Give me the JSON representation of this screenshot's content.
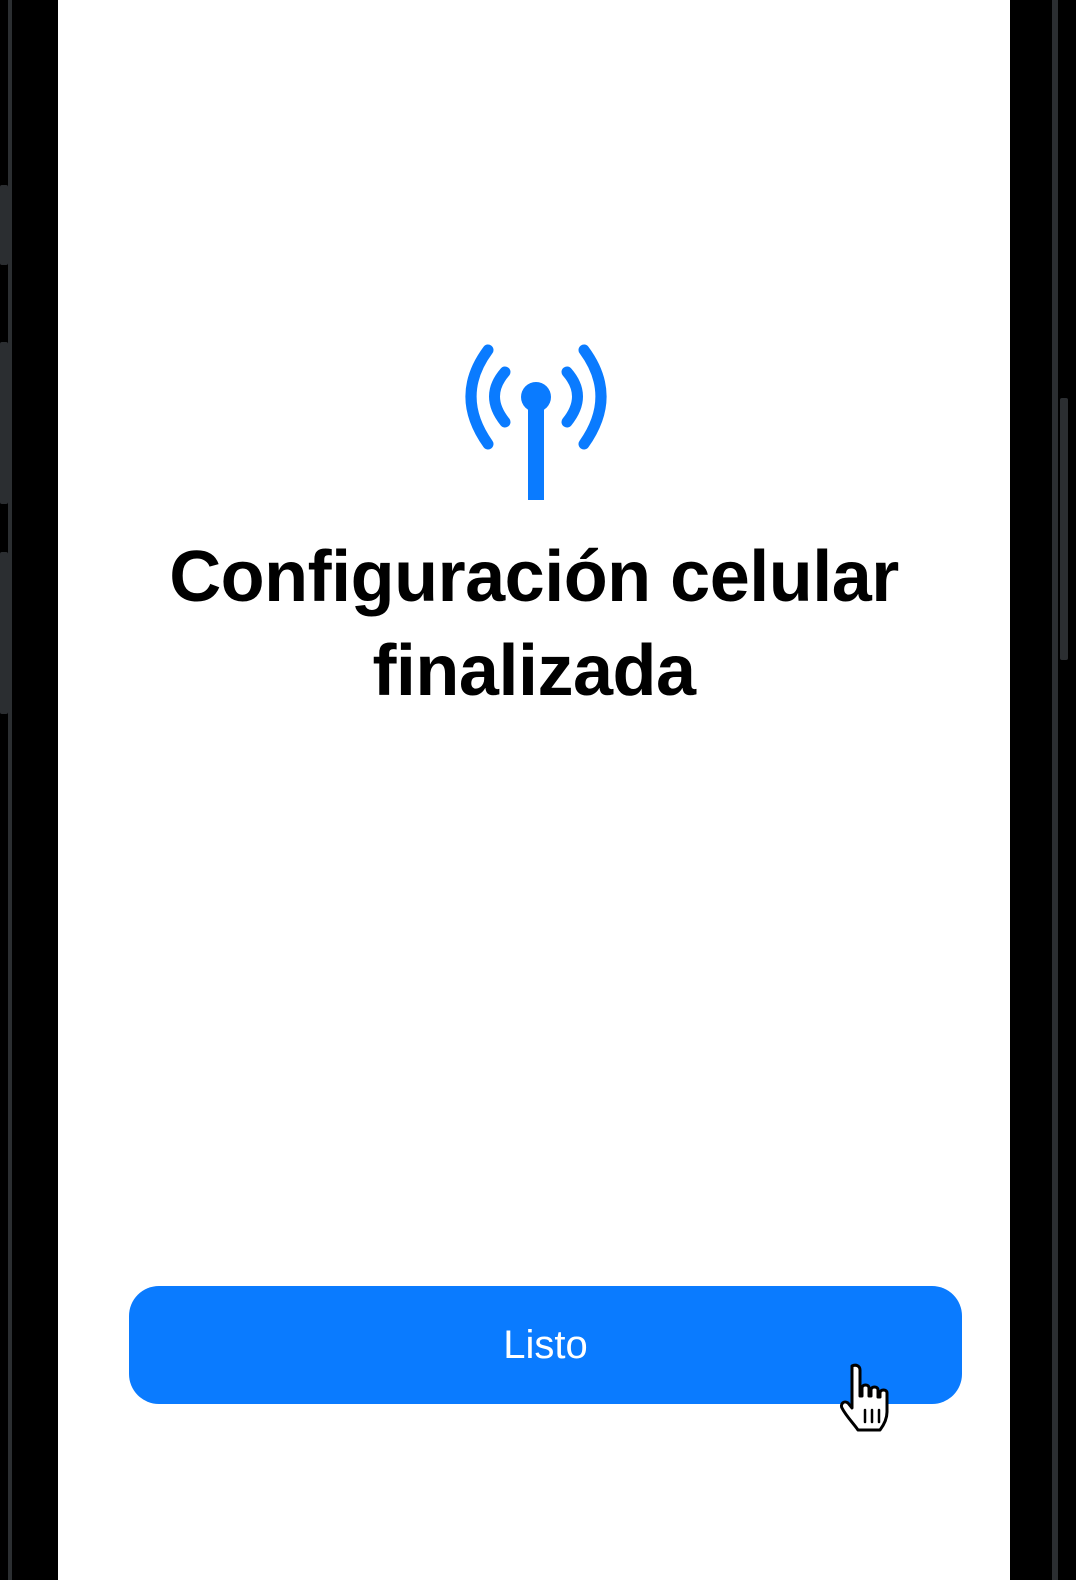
{
  "icon": "antenna-radiowaves-icon",
  "title": {
    "line1": "Configuración celular",
    "line2": "finalizada"
  },
  "done_button": {
    "label": "Listo"
  },
  "colors": {
    "accent": "#0a7bff",
    "text": "#000000",
    "background": "#ffffff"
  },
  "cursor_icon": "hand-pointer-icon"
}
